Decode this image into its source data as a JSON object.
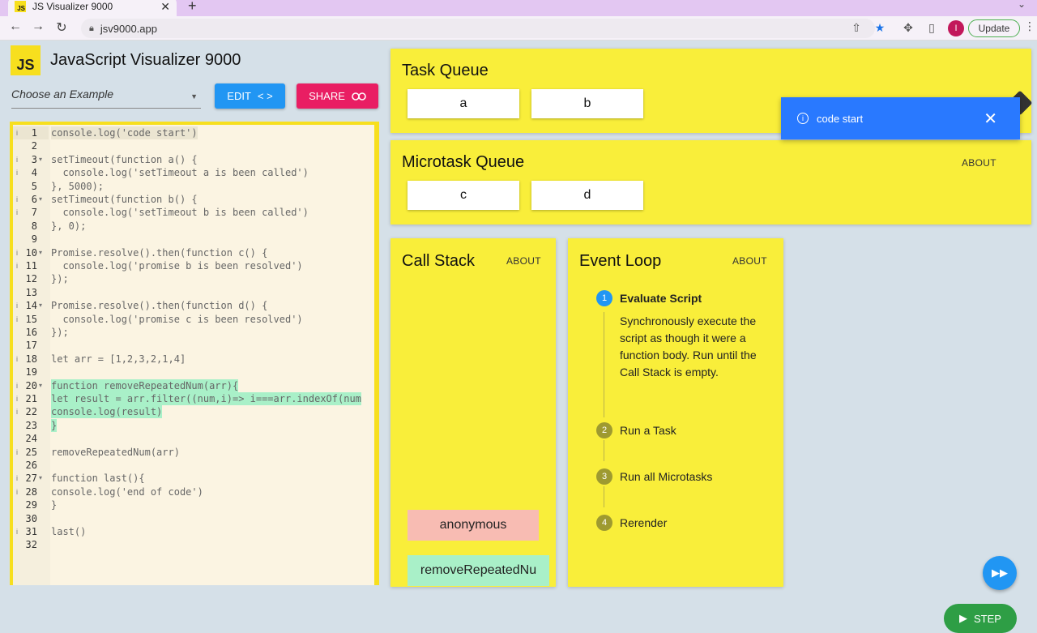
{
  "browser": {
    "tab_title": "JS Visualizer 9000",
    "tab_favicon": "JS",
    "url": "jsv9000.app",
    "update_label": "Update",
    "avatar_letter": "I"
  },
  "app": {
    "logo_text": "JS",
    "title": "JavaScript Visualizer 9000",
    "example_placeholder": "Choose an Example",
    "edit_label": "EDIT",
    "share_label": "SHARE"
  },
  "code": {
    "lines": [
      "console.log('code start')",
      "",
      "setTimeout(function a() {",
      "  console.log('setTimeout a is been called')",
      "}, 5000);",
      "setTimeout(function b() {",
      "  console.log('setTimeout b is been called')",
      "}, 0);",
      "",
      "Promise.resolve().then(function c() {",
      "  console.log('promise b is been resolved')",
      "});",
      "",
      "Promise.resolve().then(function d() {",
      "  console.log('promise c is been resolved')",
      "});",
      "",
      "let arr = [1,2,3,2,1,4]",
      "",
      "function removeRepeatedNum(arr){",
      "let result = arr.filter((num,i)=> i===arr.indexOf(num",
      "console.log(result)",
      "}",
      "",
      "removeRepeatedNum(arr)",
      "",
      "function last(){",
      "console.log('end of code')",
      "}",
      "",
      "last()",
      ""
    ],
    "line_numbers": [
      "1",
      "2",
      "3",
      "4",
      "5",
      "6",
      "7",
      "8",
      "9",
      "10",
      "11",
      "12",
      "13",
      "14",
      "15",
      "16",
      "17",
      "18",
      "19",
      "20",
      "21",
      "22",
      "23",
      "24",
      "25",
      "26",
      "27",
      "28",
      "29",
      "30",
      "31",
      "32"
    ]
  },
  "task_queue": {
    "title": "Task Queue",
    "items": [
      "a",
      "b"
    ]
  },
  "microtask_queue": {
    "title": "Microtask Queue",
    "about": "ABOUT",
    "items": [
      "c",
      "d"
    ]
  },
  "call_stack": {
    "title": "Call Stack",
    "about": "ABOUT",
    "items": [
      "anonymous",
      "removeRepeatedNu"
    ]
  },
  "event_loop": {
    "title": "Event Loop",
    "about": "ABOUT",
    "steps": [
      {
        "num": "1",
        "label": "Evaluate Script"
      },
      {
        "num": "2",
        "label": "Run a Task"
      },
      {
        "num": "3",
        "label": "Run all Microtasks"
      },
      {
        "num": "4",
        "label": "Rerender"
      }
    ],
    "active_description": "Synchronously execute the script as though it were a function body. Run until the Call Stack is empty."
  },
  "toast": {
    "message": "code start"
  },
  "controls": {
    "step_label": "STEP"
  },
  "colors": {
    "panel_yellow": "#f9ee3a",
    "edit_blue": "#2196f3",
    "share_pink": "#e91e63",
    "stack_red": "#f8bcb3",
    "stack_green": "#a9f0c8",
    "toast_blue": "#2979ff",
    "step_green": "#2e9e45"
  },
  "icons": {
    "edit": "code-brackets-icon",
    "share": "link-icon",
    "toast": "info-icon",
    "toast_close": "close-icon",
    "fast_forward": "fast-forward-icon",
    "step": "play-icon"
  }
}
